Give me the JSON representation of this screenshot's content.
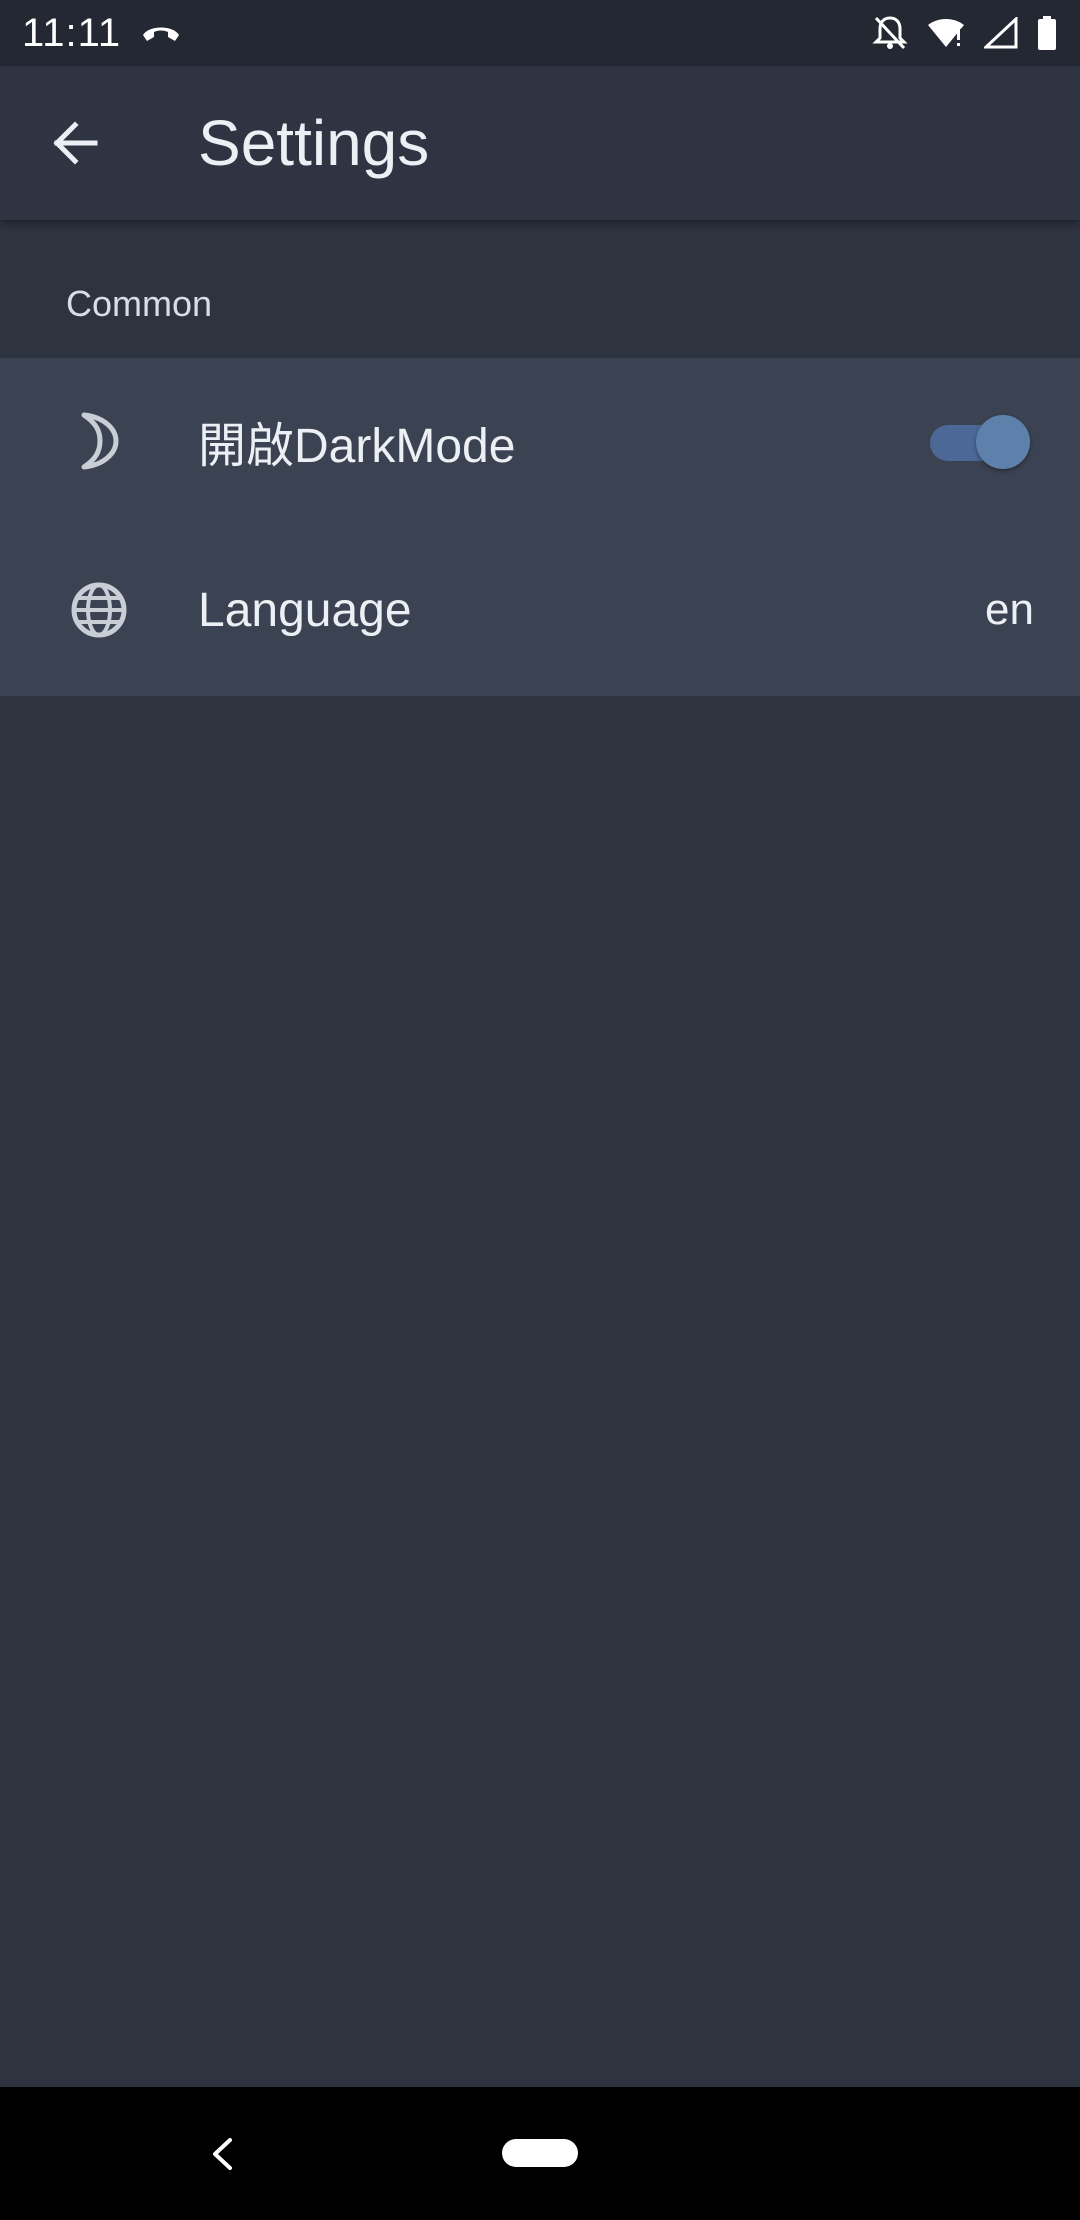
{
  "status_bar": {
    "time": "11:11",
    "icons": [
      "call-end-icon",
      "notifications-off-icon",
      "wifi-alert-icon",
      "signal-icon",
      "battery-icon"
    ]
  },
  "app_bar": {
    "title": "Settings",
    "back_icon": "arrow-back-icon"
  },
  "section": {
    "label": "Common"
  },
  "tiles": [
    {
      "icon": "moon-icon",
      "label": "開啟DarkMode",
      "type": "switch",
      "value": true
    },
    {
      "icon": "globe-icon",
      "label": "Language",
      "type": "value",
      "value": "en"
    }
  ],
  "nav_bar": {
    "icons": [
      "nav-back-icon",
      "home-pill-icon"
    ]
  },
  "colors": {
    "background": "#2e3340",
    "app_bar": "#2f3442",
    "tile_background": "#3b4252",
    "accent": "#5e81ac",
    "text": "#eceff4"
  }
}
